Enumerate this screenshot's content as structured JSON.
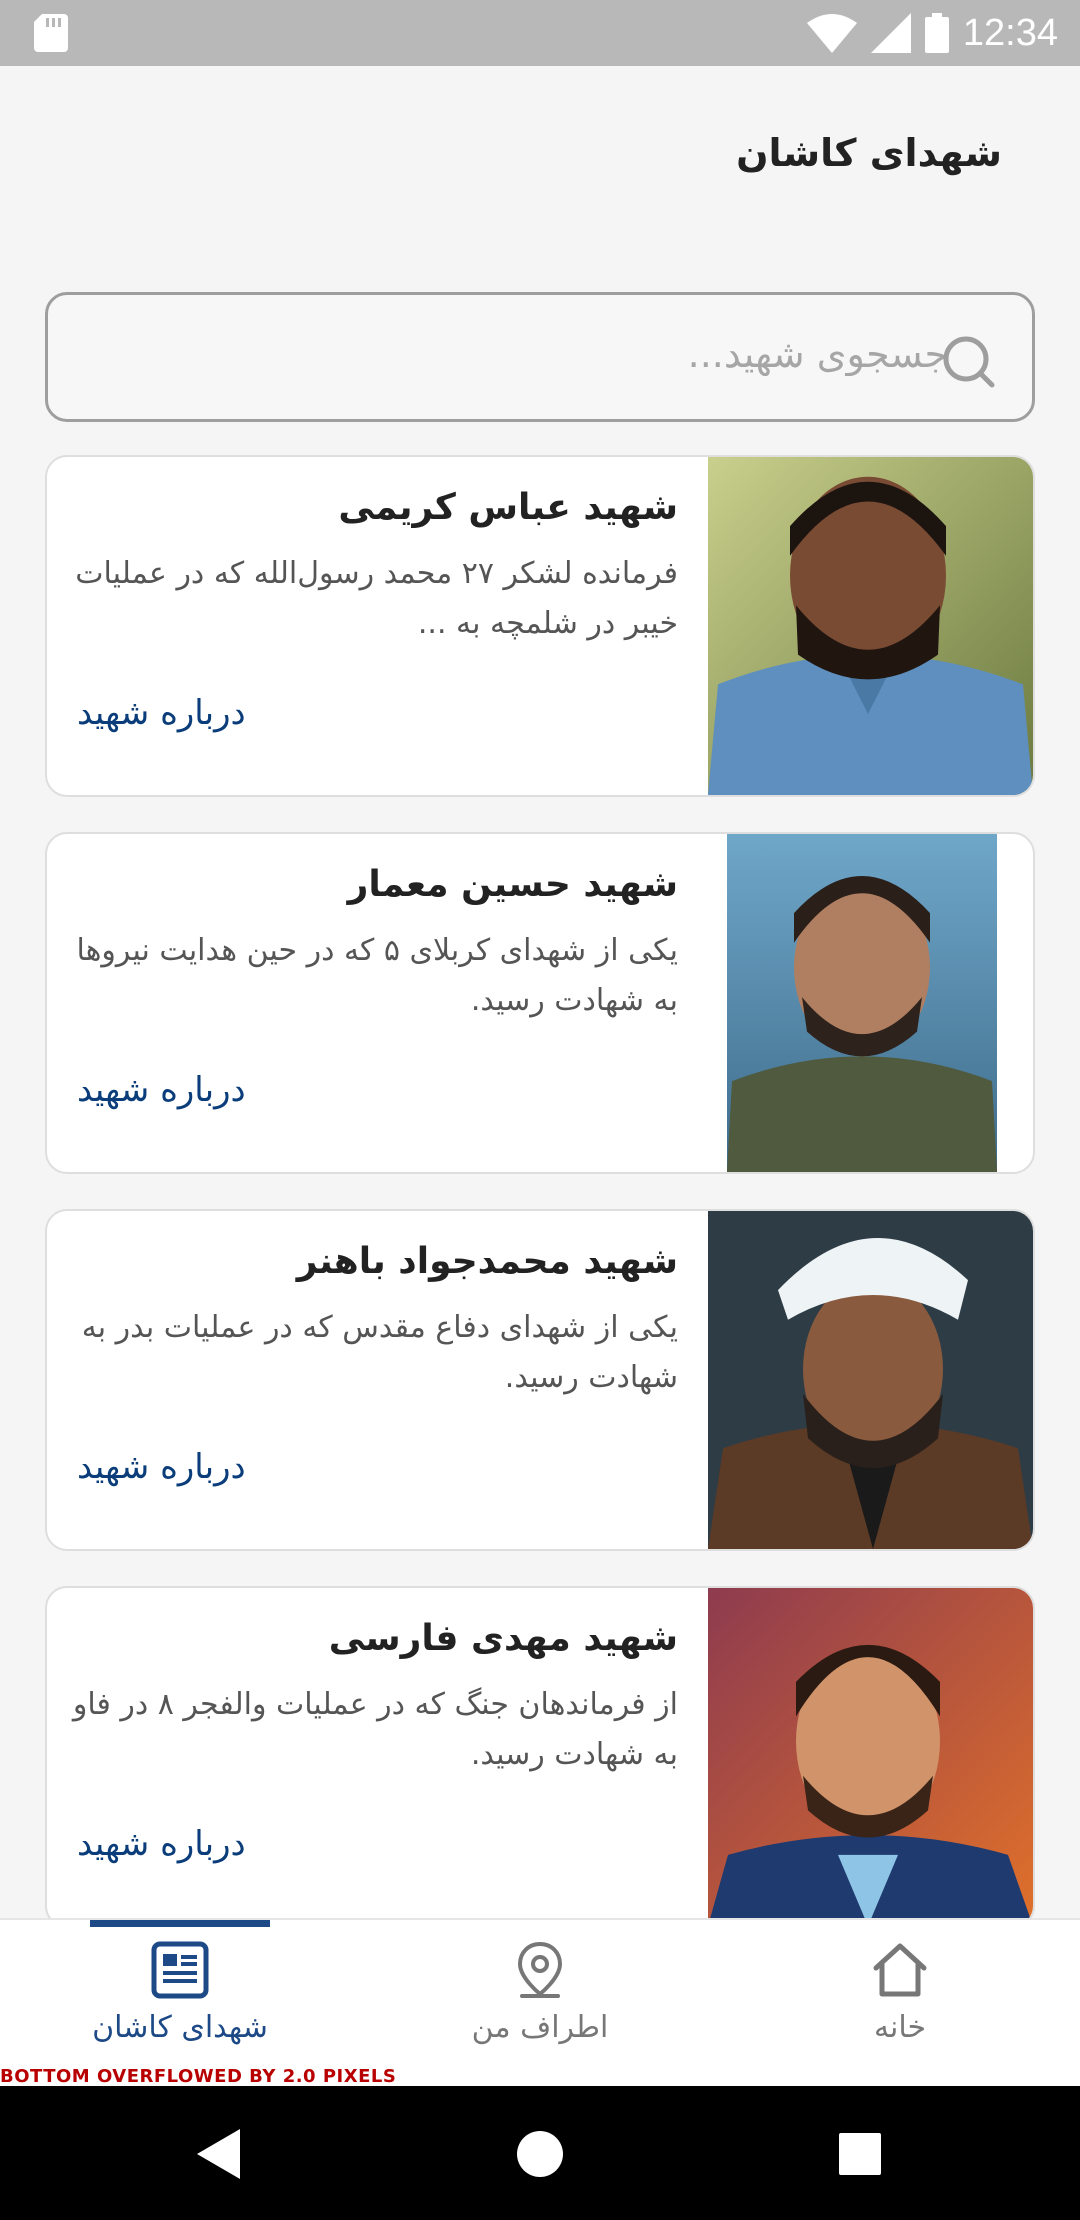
{
  "status_bar": {
    "time": "12:34",
    "icons": [
      "sd-card-icon",
      "wifi-icon",
      "signal-icon",
      "battery-icon"
    ]
  },
  "app_bar": {
    "title": "شهدای کاشان"
  },
  "search": {
    "placeholder": "جسجوی شهید..."
  },
  "cards": [
    {
      "title": "شهید عباس کریمی",
      "description": "فرمانده لشکر ۲۷ محمد رسول‌الله که در عملیات خیبر در شلمچه به ...",
      "link": "درباره شهید"
    },
    {
      "title": "شهید حسین معمار",
      "description": "یکی از شهدای کربلای ۵ که در حین هدایت نیروها به شهادت رسید.",
      "link": "درباره شهید"
    },
    {
      "title": "شهید محمدجواد باهنر",
      "description": "یکی از شهدای دفاع مقدس که در عملیات بدر به شهادت رسید.",
      "link": "درباره شهید"
    },
    {
      "title": "شهید مهدی فارسی",
      "description": "از فرماندهان جنگ که در عملیات والفجر ۸ در فاو به شهادت رسید.",
      "link": "درباره شهید"
    }
  ],
  "bottom_nav": {
    "items": [
      {
        "label": "شهدای کاشان",
        "icon": "newspaper-icon",
        "active": true
      },
      {
        "label": "اطراف من",
        "icon": "location-pin-icon",
        "active": false
      },
      {
        "label": "خانه",
        "icon": "home-icon",
        "active": false
      }
    ],
    "overflow_warning": "BOTTOM OVERFLOWED BY 2.0 PIXELS"
  },
  "colors": {
    "accent": "#1d4a86",
    "link": "#0a3d7a",
    "status_bar": "#b8b8b8",
    "background": "#f5f5f5"
  }
}
